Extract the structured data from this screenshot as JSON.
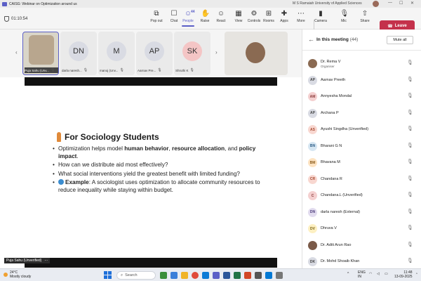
{
  "titlebar": {
    "title": "CAISG: Webinar on Optimization around us",
    "org": "M S Ramaiah University of Applied Sciences",
    "controls": [
      "—",
      "☐",
      "✕"
    ]
  },
  "toolbar": {
    "timer": "01:10:54",
    "buttons": [
      {
        "label": "Pop out",
        "icon": "pop-out-icon",
        "glyph": "⧉"
      },
      {
        "label": "Chat",
        "icon": "chat-icon",
        "glyph": "☐"
      },
      {
        "label": "People",
        "icon": "people-icon",
        "glyph": "☺",
        "badge": "44"
      },
      {
        "label": "Raise",
        "icon": "raise-hand-icon",
        "glyph": "✋"
      },
      {
        "label": "React",
        "icon": "react-icon",
        "glyph": "☺"
      },
      {
        "label": "View",
        "icon": "view-icon",
        "glyph": "▦"
      },
      {
        "label": "Controls",
        "icon": "controls-icon",
        "glyph": "⚙"
      },
      {
        "label": "Rooms",
        "icon": "rooms-icon",
        "glyph": "⊞"
      },
      {
        "label": "Apps",
        "icon": "apps-icon",
        "glyph": "✚"
      },
      {
        "label": "More",
        "icon": "more-icon",
        "glyph": "⋯"
      },
      {
        "label": "Camera",
        "icon": "camera-icon",
        "glyph": "▮"
      },
      {
        "label": "Mic",
        "icon": "mic-icon",
        "glyph": "🎙"
      },
      {
        "label": "Share",
        "icon": "share-icon",
        "glyph": "⇧"
      }
    ],
    "leave_label": "Leave"
  },
  "gallery": {
    "tiles": [
      {
        "initials": "",
        "name": "Puja Sahu (Unv...",
        "color": "#b8a68e",
        "selected": true
      },
      {
        "initials": "DN",
        "name": "darla naresh...",
        "color": "#d9dbe3"
      },
      {
        "initials": "M",
        "name": "manoj (Unv...",
        "color": "#d9dbe3"
      },
      {
        "initials": "AP",
        "name": "Aarnav Pre...",
        "color": "#d9dbe3"
      },
      {
        "initials": "SK",
        "name": "Shruthi K",
        "color": "#f4c5c5"
      }
    ]
  },
  "slide": {
    "heading": "For Sociology Students",
    "b1_pre": "Optimization helps model ",
    "b1_b1": "human behavior",
    "b1_mid": ", ",
    "b1_b2": "resource allocation",
    "b1_and": ", and ",
    "b1_b3": "policy impact",
    "b1_end": ".",
    "b2": "How can we distribute aid most effectively?",
    "b3": "What social interventions yield the greatest benefit with limited funding?",
    "b4_bold": "Example",
    "b4_text": ": A sociologist uses optimization to allocate community resources to reduce inequality while staying within budget."
  },
  "presenter_tag": "Puja Sahu (Unverified)",
  "panel": {
    "title": "In this meeting",
    "count": "(44)",
    "mute_all": "Mute all",
    "people": [
      {
        "initials": "",
        "name": "Dr. Rema V",
        "sub": "Organiser",
        "bg": "#8a6a52",
        "fg": "#fff"
      },
      {
        "initials": "AP",
        "name": "Aarnav Preeth",
        "sub": "",
        "bg": "#d9dbe3",
        "fg": "#444"
      },
      {
        "initials": "AM",
        "name": "Annyesha Mondal",
        "sub": "",
        "bg": "#f4d0d0",
        "fg": "#8a3b3b"
      },
      {
        "initials": "AP",
        "name": "Archana P",
        "sub": "",
        "bg": "#d9dbe3",
        "fg": "#444"
      },
      {
        "initials": "AS",
        "name": "Ayushi Singdha (Unverified)",
        "sub": "",
        "bg": "#f8d7d0",
        "fg": "#a6482f"
      },
      {
        "initials": "BN",
        "name": "Bharani G N",
        "sub": "",
        "bg": "#d6e6f2",
        "fg": "#2c5d86"
      },
      {
        "initials": "BM",
        "name": "Bhavana M",
        "sub": "",
        "bg": "#fde3c2",
        "fg": "#8a5b1a"
      },
      {
        "initials": "CR",
        "name": "Chandana R",
        "sub": "",
        "bg": "#f8d7d0",
        "fg": "#a6482f"
      },
      {
        "initials": "C",
        "name": "Chandana.L (Unverified)",
        "sub": "",
        "bg": "#f4d0d0",
        "fg": "#8a3b3b"
      },
      {
        "initials": "DN",
        "name": "darla naresh (External)",
        "sub": "",
        "bg": "#e2dcef",
        "fg": "#4b3b7a"
      },
      {
        "initials": "DV",
        "name": "Dhruva V",
        "sub": "",
        "bg": "#fdf0c2",
        "fg": "#7a6212"
      },
      {
        "initials": "",
        "name": "Dr. Aditi Arun Rao",
        "sub": "",
        "bg": "#7a5a48",
        "fg": "#fff"
      },
      {
        "initials": "DK",
        "name": "Dr. Mohd Shoaib Khan",
        "sub": "",
        "bg": "#d9dbe3",
        "fg": "#444"
      }
    ]
  },
  "taskbar": {
    "temp": "24°C",
    "weather": "Mostly cloudy",
    "search_placeholder": "Search",
    "lang": "ENG",
    "lang2": "IN",
    "time": "11:48",
    "date": "13-09-2025"
  },
  "colors": {
    "accent": "#5b5fc7",
    "leave": "#c4314b"
  }
}
